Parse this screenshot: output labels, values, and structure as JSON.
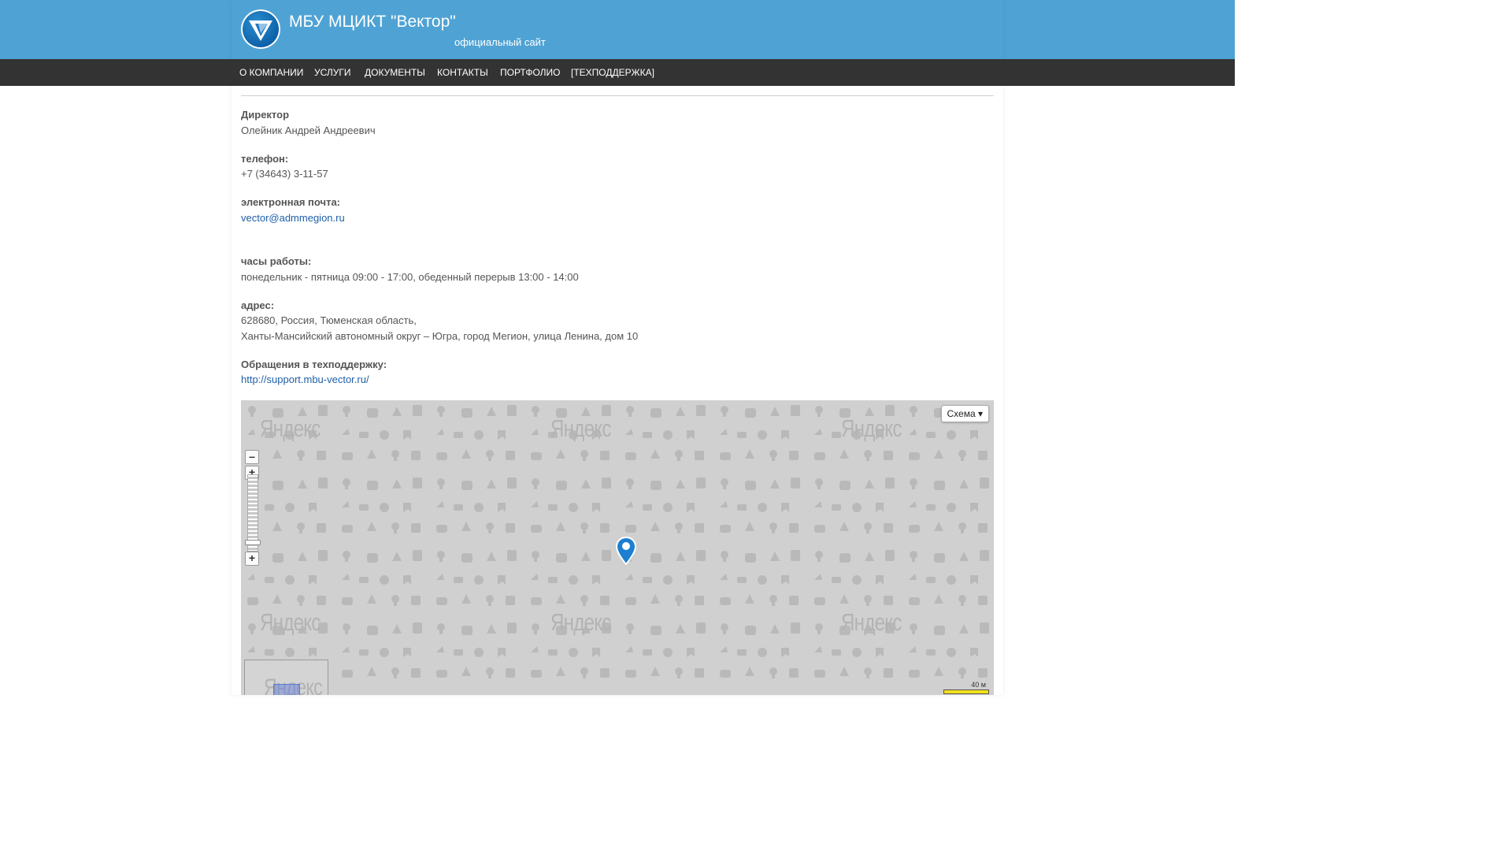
{
  "header": {
    "title": "МБУ МЦИКТ \"Вектор\"",
    "subtitle": "официальный сайт"
  },
  "nav": {
    "items": [
      {
        "label": "О КОМПАНИИ"
      },
      {
        "label": "УСЛУГИ"
      },
      {
        "label": "ДОКУМЕНТЫ"
      },
      {
        "label": "КОНТАКТЫ"
      },
      {
        "label": "ПОРТФОЛИО"
      },
      {
        "label": "[ТЕХПОДДЕРЖКА]"
      }
    ]
  },
  "contacts": {
    "director_label": "Директор",
    "director_name": "Олейник Андрей Андреевич",
    "phone_label": "телефон:",
    "phone": "+7 (34643) 3-11-57",
    "email_label": "электронная почта:",
    "email": "vector@admmegion.ru",
    "hours_label": "часы работы:",
    "hours": "понедельник - пятница 09:00 - 17:00, обеденный перерыв 13:00 - 14:00",
    "address_label": "адрес:",
    "address_line1": "628680, Россия, Тюменская область,",
    "address_line2": "Ханты-Мансийский автономный округ – Югра, город Мегион, улица Ленина, дом 10",
    "support_label": "Обращения в техподдержку:",
    "support_url": "http://support.mbu-vector.ru/"
  },
  "map": {
    "type_button": "Схема ▾",
    "watermark": "Яндекс",
    "scale_label": "40 м",
    "zoom_in": "+",
    "zoom_out": "–"
  },
  "colors": {
    "header_bg": "#4fa3d4",
    "nav_bg": "#333333",
    "link": "#1f5fa9"
  }
}
